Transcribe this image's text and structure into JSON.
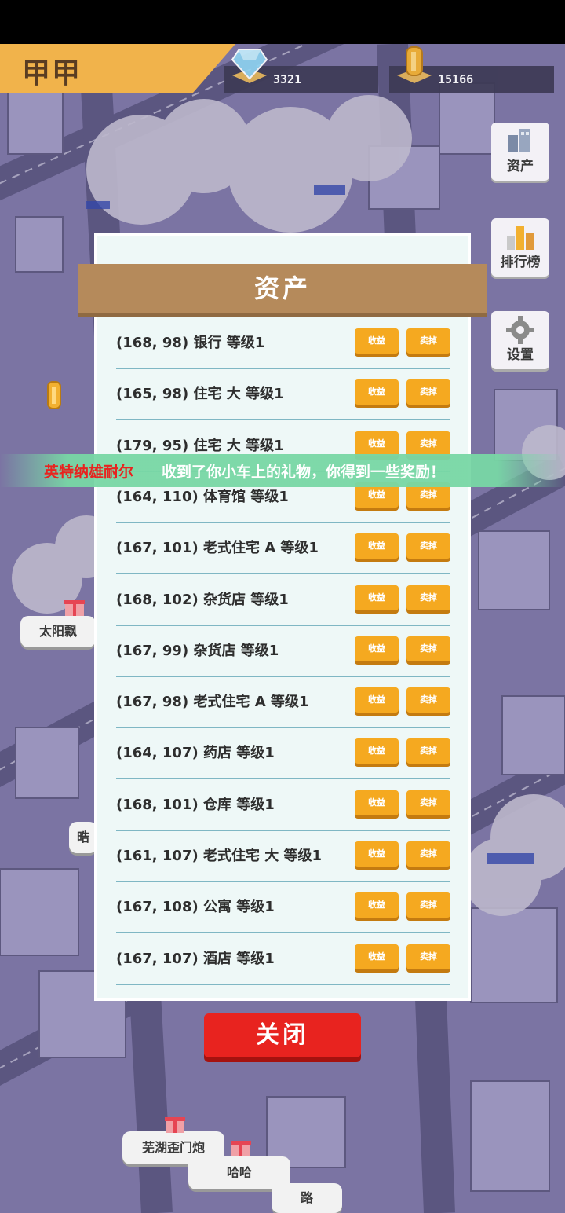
{
  "header": {
    "player_name": "甲甲",
    "diamonds": "3321",
    "coins": "15166"
  },
  "side_menu": {
    "assets_label": "资产",
    "leaderboard_label": "排行榜",
    "settings_label": "设置"
  },
  "panel": {
    "title": "资产",
    "rows": [
      {
        "text": "(168, 98) 银行 等级1",
        "income": "收益",
        "sell": "卖掉"
      },
      {
        "text": "(165, 98) 住宅 大 等级1",
        "income": "收益",
        "sell": "卖掉"
      },
      {
        "text": "(179, 95) 住宅 大 等级1",
        "income": "收益",
        "sell": "卖掉"
      },
      {
        "text": "(164, 110) 体育馆 等级1",
        "income": "收益",
        "sell": "卖掉"
      },
      {
        "text": "(167, 101) 老式住宅 A 等级1",
        "income": "收益",
        "sell": "卖掉"
      },
      {
        "text": "(168, 102) 杂货店 等级1",
        "income": "收益",
        "sell": "卖掉"
      },
      {
        "text": "(167, 99) 杂货店 等级1",
        "income": "收益",
        "sell": "卖掉"
      },
      {
        "text": "(167, 98) 老式住宅 A 等级1",
        "income": "收益",
        "sell": "卖掉"
      },
      {
        "text": "(164, 107) 药店 等级1",
        "income": "收益",
        "sell": "卖掉"
      },
      {
        "text": "(168, 101) 仓库 等级1",
        "income": "收益",
        "sell": "卖掉"
      },
      {
        "text": "(161, 107) 老式住宅 大 等级1",
        "income": "收益",
        "sell": "卖掉"
      },
      {
        "text": "(167, 108) 公寓 等级1",
        "income": "收益",
        "sell": "卖掉"
      },
      {
        "text": "(167, 107) 酒店 等级1",
        "income": "收益",
        "sell": "卖掉"
      }
    ],
    "close_label": "关闭"
  },
  "toast": {
    "player": "英特纳雄耐尔",
    "message": "收到了你小车上的礼物，你得到一些奖励！"
  },
  "map_labels": {
    "label1": "太阳飘",
    "label2": "芜湖歪门炮",
    "label3": "哈哈",
    "label4": "路",
    "label5": "晧"
  },
  "colors": {
    "panel_bg": "#eef8f7",
    "header_brown": "#b58a5b",
    "button_orange": "#f5a920",
    "close_red": "#e8231f",
    "toast_green": "#78d7a5",
    "map_purple": "#7b74a3"
  }
}
